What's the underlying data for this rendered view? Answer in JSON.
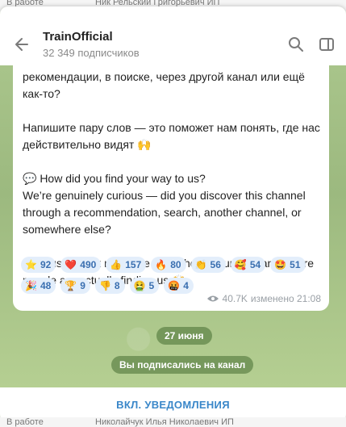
{
  "background": {
    "top_left": "В работе",
    "top_mid": "Ник Рельский Григорьевич ИП",
    "bottom_left": "В работе",
    "bottom_mid": "Николайчук Илья Николаевич ИП"
  },
  "header": {
    "title": "TrainOfficial",
    "subtitle": "32 349 подписчиков",
    "back_icon": "arrow-left-icon",
    "search_icon": "search-icon",
    "sidebar_icon": "sidebar-toggle-icon"
  },
  "message": {
    "text": "рекомендации, в поиске, через другой канал или ещё как-то?\n\nНапишите пару слов — это поможет нам понять, где нас действительно видят 🙌\n\n💬 How did you find your way to us?\nWe’re genuinely curious — did you discover this channel through a recommendation, search, another channel, or somewhere else?\n\nDrop us a quick message — it’ll help us understand where people are actually finding us 🙌",
    "views": "40.7K",
    "edited_time": "изменено 21:08"
  },
  "reactions": [
    {
      "emoji": "⭐",
      "count": "92"
    },
    {
      "emoji": "❤️",
      "count": "490"
    },
    {
      "emoji": "👍",
      "count": "157"
    },
    {
      "emoji": "🔥",
      "count": "80"
    },
    {
      "emoji": "👏",
      "count": "56"
    },
    {
      "emoji": "🥰",
      "count": "54"
    },
    {
      "emoji": "🤩",
      "count": "51"
    },
    {
      "emoji": "🎉",
      "count": "48"
    },
    {
      "emoji": "🏆",
      "count": "9"
    },
    {
      "emoji": "👎",
      "count": "8"
    },
    {
      "emoji": "🤮",
      "count": "5"
    },
    {
      "emoji": "🤬",
      "count": "4"
    }
  ],
  "date_divider": "27 июня",
  "service_message": "Вы подписались на канал",
  "footer": {
    "notify_label": "ВКЛ. УВЕДОМЛЕНИЯ"
  },
  "colors": {
    "accent": "#3a87c9",
    "reaction_bg": "#e3eefb",
    "chat_bg": "#a8c48a"
  }
}
